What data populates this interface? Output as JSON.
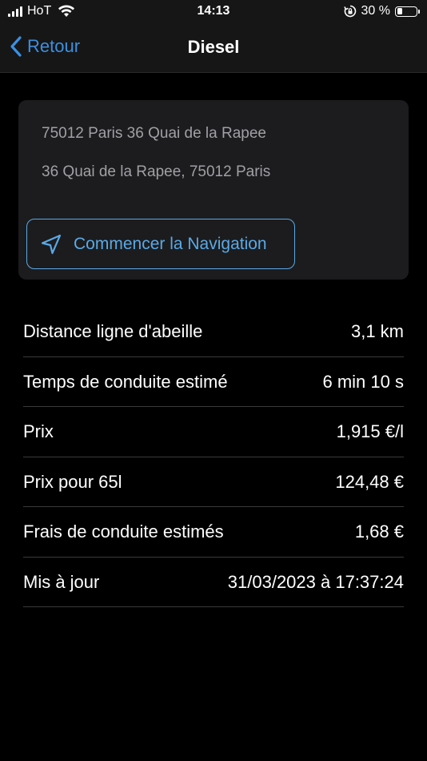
{
  "status_bar": {
    "carrier": "HoT",
    "time": "14:13",
    "battery_percent": "30 %",
    "battery_level": 0.3,
    "icons": [
      "signal-icon",
      "wifi-icon",
      "rotation-lock-icon",
      "battery-icon"
    ]
  },
  "nav": {
    "back_label": "Retour",
    "title": "Diesel",
    "accent_color": "#3c8fe0"
  },
  "address": {
    "line1": "75012 Paris 36 Quai de la Rapee",
    "line2": "36 Quai de la Rapee, 75012 Paris",
    "navigation_button": "Commencer la Navigation",
    "navigation_icon": "location-arrow-icon"
  },
  "info": {
    "rows": [
      {
        "label": "Distance ligne d'abeille",
        "value": "3,1 km"
      },
      {
        "label": "Temps de conduite estimé",
        "value": "6 min 10 s"
      },
      {
        "label": "Prix",
        "value": "1,915 €/l"
      },
      {
        "label": "Prix pour 65l",
        "value": "124,48 €"
      },
      {
        "label": "Frais de conduite estimés",
        "value": "1,68 €"
      },
      {
        "label": "Mis à jour",
        "value": "31/03/2023 à 17:37:24"
      }
    ]
  }
}
